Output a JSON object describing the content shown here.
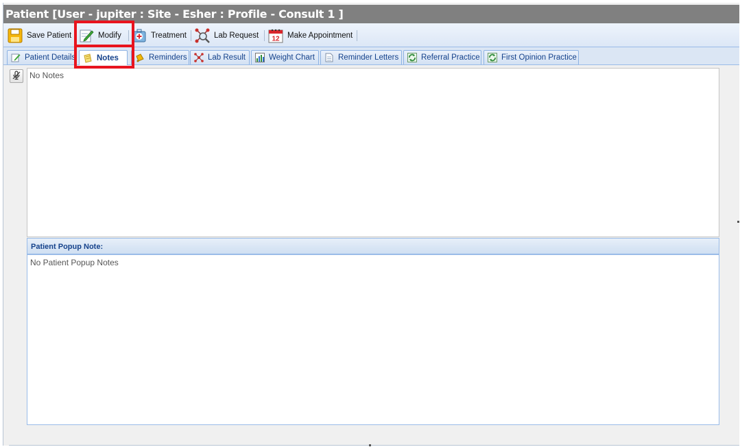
{
  "window": {
    "title": "Patient [User - jupiter : Site - Esher : Profile - Consult 1 ]"
  },
  "toolbar": {
    "buttons": [
      {
        "label": "Save Patient",
        "icon": "floppy-disk-icon"
      },
      {
        "label": "Modify",
        "icon": "pencil-edit-icon"
      },
      {
        "label": "Treatment",
        "icon": "medical-kit-icon"
      },
      {
        "label": "Lab Request",
        "icon": "molecule-magnifier-icon"
      },
      {
        "label": "Make Appointment",
        "icon": "calendar-icon",
        "icon_text": "12"
      }
    ]
  },
  "tabs": [
    {
      "label": "Patient Details",
      "icon": "edit-document-icon",
      "active": false
    },
    {
      "label": "Notes",
      "icon": "notes-icon",
      "active": true
    },
    {
      "label": "Reminders",
      "icon": "bell-icon",
      "active": false
    },
    {
      "label": "Lab Result",
      "icon": "molecule-icon",
      "active": false
    },
    {
      "label": "Weight Chart",
      "icon": "bar-chart-icon",
      "active": false
    },
    {
      "label": "Reminder Letters",
      "icon": "document-icon",
      "active": false
    },
    {
      "label": "Referral Practice",
      "icon": "refresh-arrows-icon",
      "active": false
    },
    {
      "label": "First Opinion Practice",
      "icon": "refresh-arrows-icon",
      "active": false
    }
  ],
  "notes": {
    "content": "No Notes",
    "mic_icon": "microphone-muted-icon"
  },
  "popup": {
    "header": "Patient Popup Note:",
    "content": "No Patient Popup Notes"
  },
  "colors": {
    "highlight": "#e8141e",
    "title_bar": "#808080",
    "tab_text": "#15428b"
  }
}
